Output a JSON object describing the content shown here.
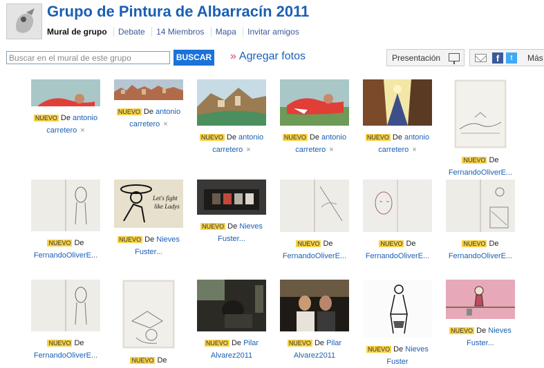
{
  "group": {
    "title": "Grupo de Pintura de Albarracín 2011",
    "nav": [
      "Mural de grupo",
      "Debate",
      "14 Miembros",
      "Mapa",
      "Invitar amigos"
    ]
  },
  "toolbar": {
    "search_placeholder": "Buscar en el mural de este grupo",
    "search_button": "BUSCAR",
    "add_photos": "Agregar fotos",
    "add_photos_prefix": "»",
    "presentation": "Presentación",
    "more": "Más"
  },
  "labels": {
    "badge": "NUEVO",
    "by": "De",
    "remove": "×"
  },
  "photos": [
    {
      "author_l1": "antonio",
      "author_l2": "carretero",
      "removable": true,
      "subject": "watercolor-reclining-figure"
    },
    {
      "author_l1": "antonio",
      "author_l2": "carretero",
      "removable": true,
      "subject": "watercolor-town-panorama"
    },
    {
      "author_l1": "antonio",
      "author_l2": "carretero",
      "removable": true,
      "subject": "watercolor-town-hill"
    },
    {
      "author_l1": "antonio",
      "author_l2": "carretero",
      "removable": true,
      "subject": "watercolor-reclining-figure"
    },
    {
      "author_l1": "antonio",
      "author_l2": "carretero",
      "removable": true,
      "subject": "watercolor-street-night"
    },
    {
      "author_l1": "",
      "author_l2": "FernandoOliverE...",
      "removable": false,
      "subject": "sketch-landscape"
    },
    {
      "author_l1": "",
      "author_l2": "FernandoOliverE...",
      "removable": false,
      "subject": "sketchbook-figure"
    },
    {
      "author_l1": "Nieves",
      "author_l2": "Fuster...",
      "removable": false,
      "subject": "ink-drawing-lets-fight"
    },
    {
      "author_l1": "Nieves",
      "author_l2": "Fuster...",
      "removable": false,
      "subject": "photo-screen"
    },
    {
      "author_l1": "",
      "author_l2": "FernandoOliverE...",
      "removable": false,
      "subject": "sketchbook-pencil"
    },
    {
      "author_l1": "",
      "author_l2": "FernandoOliverE...",
      "removable": false,
      "subject": "sketchbook-portrait"
    },
    {
      "author_l1": "",
      "author_l2": "FernandoOliverE...",
      "removable": false,
      "subject": "sketchbook-scene"
    },
    {
      "author_l1": "",
      "author_l2": "FernandoOliverE...",
      "removable": false,
      "subject": "sketchbook-figure"
    },
    {
      "author_l1": "",
      "author_l2": "",
      "removable": false,
      "subject": "sketch-character"
    },
    {
      "author_l1": "Pilar",
      "author_l2": "Alvarez2011",
      "removable": false,
      "subject": "photo-room"
    },
    {
      "author_l1": "Pilar",
      "author_l2": "Alvarez2011",
      "removable": false,
      "subject": "photo-people-night"
    },
    {
      "author_l1": "Nieves",
      "author_l2": "Fuster",
      "removable": false,
      "subject": "ink-figure"
    },
    {
      "author_l1": "Nieves",
      "author_l2": "Fuster...",
      "removable": false,
      "subject": "pink-cartoon"
    }
  ]
}
